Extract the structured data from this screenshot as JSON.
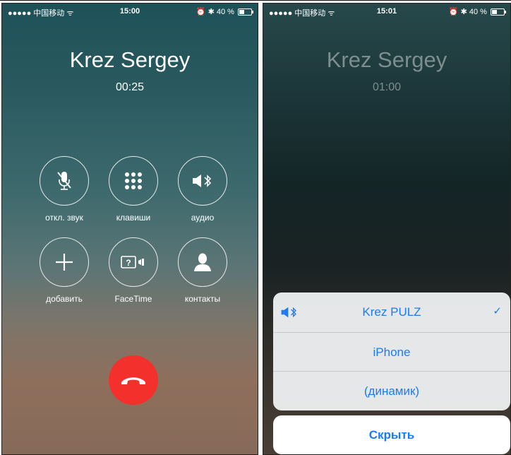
{
  "left_screen": {
    "status_bar": {
      "carrier": "●●●●● 中国移动",
      "time": "15:00",
      "battery": "40 %"
    },
    "caller_name": "Krez Sergey",
    "call_duration": "00:25",
    "controls": {
      "mute": {
        "icon": "muted-microphone-icon",
        "label": "откл. звук"
      },
      "keypad": {
        "icon": "keypad-icon",
        "label": "клавиши"
      },
      "audio": {
        "icon": "bluetooth-speaker-icon",
        "label": "аудио"
      },
      "add": {
        "icon": "plus-icon",
        "label": "добавить"
      },
      "facetime": {
        "icon": "facetime-icon",
        "label": "FaceTime"
      },
      "contacts": {
        "icon": "person-icon",
        "label": "контакты"
      }
    },
    "end_call": {
      "icon": "end-call-icon",
      "color": "#f3302c"
    }
  },
  "right_screen": {
    "status_bar": {
      "carrier": "●●●●● 中国移动",
      "time": "15:01",
      "battery": "40 %"
    },
    "caller_name": "Krez Sergey",
    "call_duration": "01:00",
    "audio_routes": [
      {
        "label": "Krez PULZ",
        "selected": true,
        "icon": "bluetooth-speaker-icon"
      },
      {
        "label": "iPhone",
        "selected": false
      },
      {
        "label": "(динамик)",
        "selected": false
      }
    ],
    "hide_label": "Скрыть",
    "accent_color": "#1a7cf3"
  }
}
